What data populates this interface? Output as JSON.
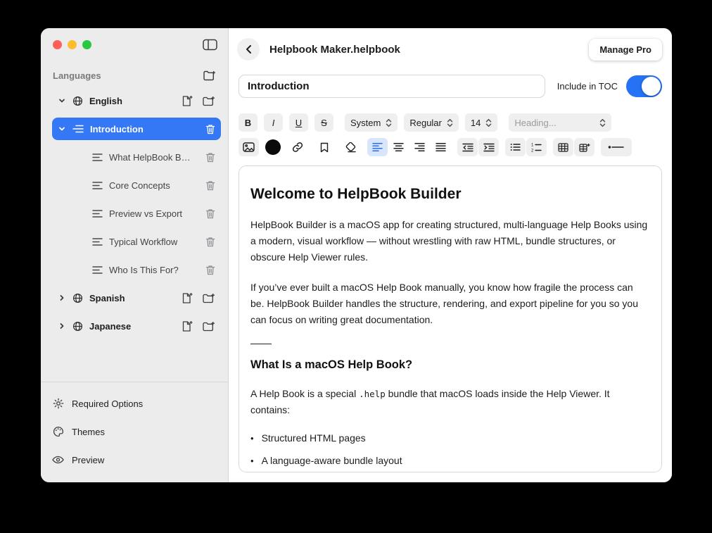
{
  "window": {
    "doc_title": "Helpbook Maker.helpbook",
    "manage_pro": "Manage Pro"
  },
  "sidebar": {
    "header": "Languages",
    "english": {
      "label": "English"
    },
    "introduction": {
      "label": "Introduction"
    },
    "subpages": [
      "What HelpBook Buil…",
      "Core Concepts",
      "Preview vs Export",
      "Typical Workflow",
      "Who Is This For?"
    ],
    "spanish": {
      "label": "Spanish"
    },
    "japanese": {
      "label": "Japanese"
    },
    "footer": {
      "required_options": "Required Options",
      "themes": "Themes",
      "preview": "Preview"
    }
  },
  "page": {
    "title_value": "Introduction",
    "include_toc_label": "Include in TOC",
    "include_in_toc_on": true
  },
  "toolbar": {
    "bold": "B",
    "italic": "I",
    "underline": "U",
    "strike": "S",
    "font_family": "System",
    "font_weight": "Regular",
    "font_size": "14",
    "heading_placeholder": "Heading..."
  },
  "editor": {
    "h1": "Welcome to HelpBook Builder",
    "p1": "HelpBook Builder is a macOS app for creating structured, multi-language Help Books using a modern, visual workflow — without wrestling with raw HTML, bundle structures, or obscure Help Viewer rules.",
    "p2": "If you’ve ever built a macOS Help Book manually, you know how fragile the process can be. HelpBook Builder handles the structure, rendering, and export pipeline for you so you can focus on writing great documentation.",
    "h2": "What Is a macOS Help Book?",
    "p3_before": "A Help Book is a special ",
    "p3_code": ".help",
    "p3_after": " bundle that macOS loads inside the Help Viewer. It contains:",
    "bullets": [
      "Structured HTML pages",
      "A language-aware bundle layout"
    ]
  },
  "colors": {
    "accent": "#3478f6",
    "toggle_on": "#2572f5",
    "selected_row": "#3478f6"
  }
}
